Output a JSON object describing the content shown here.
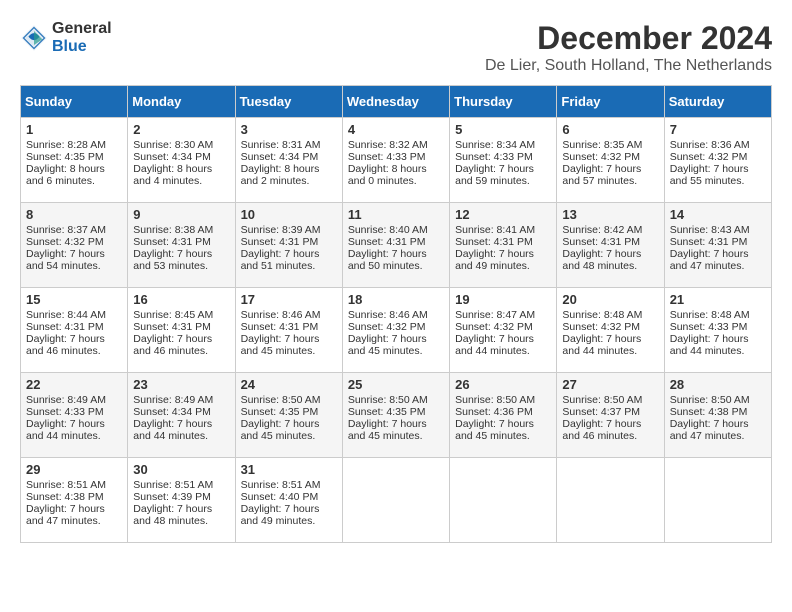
{
  "header": {
    "logo_line1": "General",
    "logo_line2": "Blue",
    "title": "December 2024",
    "subtitle": "De Lier, South Holland, The Netherlands"
  },
  "calendar": {
    "days_of_week": [
      "Sunday",
      "Monday",
      "Tuesday",
      "Wednesday",
      "Thursday",
      "Friday",
      "Saturday"
    ],
    "weeks": [
      [
        {
          "day": "",
          "sunrise": "",
          "sunset": "",
          "daylight": ""
        },
        {
          "day": "",
          "sunrise": "",
          "sunset": "",
          "daylight": ""
        },
        {
          "day": "",
          "sunrise": "",
          "sunset": "",
          "daylight": ""
        },
        {
          "day": "",
          "sunrise": "",
          "sunset": "",
          "daylight": ""
        },
        {
          "day": "",
          "sunrise": "",
          "sunset": "",
          "daylight": ""
        },
        {
          "day": "",
          "sunrise": "",
          "sunset": "",
          "daylight": ""
        },
        {
          "day": "",
          "sunrise": "",
          "sunset": "",
          "daylight": ""
        }
      ],
      [
        {
          "day": "1",
          "sunrise": "Sunrise: 8:28 AM",
          "sunset": "Sunset: 4:35 PM",
          "daylight": "Daylight: 8 hours and 6 minutes."
        },
        {
          "day": "2",
          "sunrise": "Sunrise: 8:30 AM",
          "sunset": "Sunset: 4:34 PM",
          "daylight": "Daylight: 8 hours and 4 minutes."
        },
        {
          "day": "3",
          "sunrise": "Sunrise: 8:31 AM",
          "sunset": "Sunset: 4:34 PM",
          "daylight": "Daylight: 8 hours and 2 minutes."
        },
        {
          "day": "4",
          "sunrise": "Sunrise: 8:32 AM",
          "sunset": "Sunset: 4:33 PM",
          "daylight": "Daylight: 8 hours and 0 minutes."
        },
        {
          "day": "5",
          "sunrise": "Sunrise: 8:34 AM",
          "sunset": "Sunset: 4:33 PM",
          "daylight": "Daylight: 7 hours and 59 minutes."
        },
        {
          "day": "6",
          "sunrise": "Sunrise: 8:35 AM",
          "sunset": "Sunset: 4:32 PM",
          "daylight": "Daylight: 7 hours and 57 minutes."
        },
        {
          "day": "7",
          "sunrise": "Sunrise: 8:36 AM",
          "sunset": "Sunset: 4:32 PM",
          "daylight": "Daylight: 7 hours and 55 minutes."
        }
      ],
      [
        {
          "day": "8",
          "sunrise": "Sunrise: 8:37 AM",
          "sunset": "Sunset: 4:32 PM",
          "daylight": "Daylight: 7 hours and 54 minutes."
        },
        {
          "day": "9",
          "sunrise": "Sunrise: 8:38 AM",
          "sunset": "Sunset: 4:31 PM",
          "daylight": "Daylight: 7 hours and 53 minutes."
        },
        {
          "day": "10",
          "sunrise": "Sunrise: 8:39 AM",
          "sunset": "Sunset: 4:31 PM",
          "daylight": "Daylight: 7 hours and 51 minutes."
        },
        {
          "day": "11",
          "sunrise": "Sunrise: 8:40 AM",
          "sunset": "Sunset: 4:31 PM",
          "daylight": "Daylight: 7 hours and 50 minutes."
        },
        {
          "day": "12",
          "sunrise": "Sunrise: 8:41 AM",
          "sunset": "Sunset: 4:31 PM",
          "daylight": "Daylight: 7 hours and 49 minutes."
        },
        {
          "day": "13",
          "sunrise": "Sunrise: 8:42 AM",
          "sunset": "Sunset: 4:31 PM",
          "daylight": "Daylight: 7 hours and 48 minutes."
        },
        {
          "day": "14",
          "sunrise": "Sunrise: 8:43 AM",
          "sunset": "Sunset: 4:31 PM",
          "daylight": "Daylight: 7 hours and 47 minutes."
        }
      ],
      [
        {
          "day": "15",
          "sunrise": "Sunrise: 8:44 AM",
          "sunset": "Sunset: 4:31 PM",
          "daylight": "Daylight: 7 hours and 46 minutes."
        },
        {
          "day": "16",
          "sunrise": "Sunrise: 8:45 AM",
          "sunset": "Sunset: 4:31 PM",
          "daylight": "Daylight: 7 hours and 46 minutes."
        },
        {
          "day": "17",
          "sunrise": "Sunrise: 8:46 AM",
          "sunset": "Sunset: 4:31 PM",
          "daylight": "Daylight: 7 hours and 45 minutes."
        },
        {
          "day": "18",
          "sunrise": "Sunrise: 8:46 AM",
          "sunset": "Sunset: 4:32 PM",
          "daylight": "Daylight: 7 hours and 45 minutes."
        },
        {
          "day": "19",
          "sunrise": "Sunrise: 8:47 AM",
          "sunset": "Sunset: 4:32 PM",
          "daylight": "Daylight: 7 hours and 44 minutes."
        },
        {
          "day": "20",
          "sunrise": "Sunrise: 8:48 AM",
          "sunset": "Sunset: 4:32 PM",
          "daylight": "Daylight: 7 hours and 44 minutes."
        },
        {
          "day": "21",
          "sunrise": "Sunrise: 8:48 AM",
          "sunset": "Sunset: 4:33 PM",
          "daylight": "Daylight: 7 hours and 44 minutes."
        }
      ],
      [
        {
          "day": "22",
          "sunrise": "Sunrise: 8:49 AM",
          "sunset": "Sunset: 4:33 PM",
          "daylight": "Daylight: 7 hours and 44 minutes."
        },
        {
          "day": "23",
          "sunrise": "Sunrise: 8:49 AM",
          "sunset": "Sunset: 4:34 PM",
          "daylight": "Daylight: 7 hours and 44 minutes."
        },
        {
          "day": "24",
          "sunrise": "Sunrise: 8:50 AM",
          "sunset": "Sunset: 4:35 PM",
          "daylight": "Daylight: 7 hours and 45 minutes."
        },
        {
          "day": "25",
          "sunrise": "Sunrise: 8:50 AM",
          "sunset": "Sunset: 4:35 PM",
          "daylight": "Daylight: 7 hours and 45 minutes."
        },
        {
          "day": "26",
          "sunrise": "Sunrise: 8:50 AM",
          "sunset": "Sunset: 4:36 PM",
          "daylight": "Daylight: 7 hours and 45 minutes."
        },
        {
          "day": "27",
          "sunrise": "Sunrise: 8:50 AM",
          "sunset": "Sunset: 4:37 PM",
          "daylight": "Daylight: 7 hours and 46 minutes."
        },
        {
          "day": "28",
          "sunrise": "Sunrise: 8:50 AM",
          "sunset": "Sunset: 4:38 PM",
          "daylight": "Daylight: 7 hours and 47 minutes."
        }
      ],
      [
        {
          "day": "29",
          "sunrise": "Sunrise: 8:51 AM",
          "sunset": "Sunset: 4:38 PM",
          "daylight": "Daylight: 7 hours and 47 minutes."
        },
        {
          "day": "30",
          "sunrise": "Sunrise: 8:51 AM",
          "sunset": "Sunset: 4:39 PM",
          "daylight": "Daylight: 7 hours and 48 minutes."
        },
        {
          "day": "31",
          "sunrise": "Sunrise: 8:51 AM",
          "sunset": "Sunset: 4:40 PM",
          "daylight": "Daylight: 7 hours and 49 minutes."
        },
        {
          "day": "",
          "sunrise": "",
          "sunset": "",
          "daylight": ""
        },
        {
          "day": "",
          "sunrise": "",
          "sunset": "",
          "daylight": ""
        },
        {
          "day": "",
          "sunrise": "",
          "sunset": "",
          "daylight": ""
        },
        {
          "day": "",
          "sunrise": "",
          "sunset": "",
          "daylight": ""
        }
      ]
    ]
  }
}
